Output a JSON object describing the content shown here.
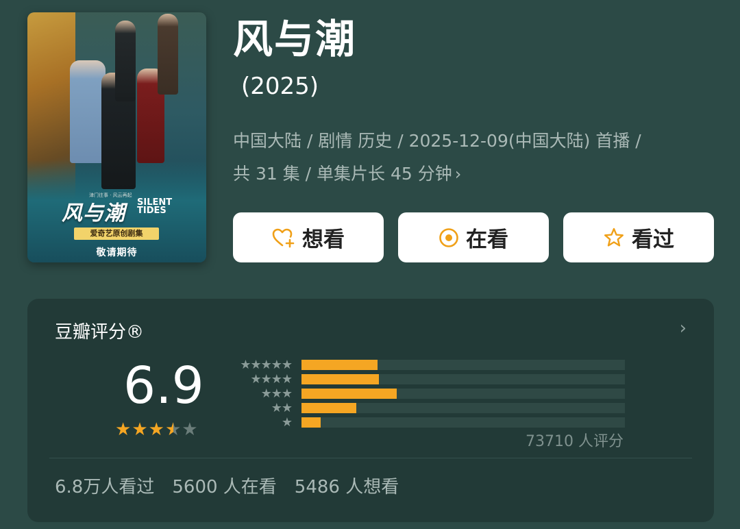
{
  "poster": {
    "title": "风与潮",
    "title_en": "SILENT TIDES",
    "tagline": "津门往事 · 风云再起",
    "tag": "爱奇艺原创剧集",
    "coming_soon": "敬请期待"
  },
  "show": {
    "title": "风与潮",
    "year": "(2025)",
    "meta_line1": "中国大陆 / 剧情 历史 / 2025-12-09(中国大陆) 首播 /",
    "meta_line2": "共 31 集 / 单集片长 45 分钟",
    "more_icon": "chevron-right-icon"
  },
  "actions": {
    "want": {
      "label": "想看",
      "icon": "heart-plus-icon"
    },
    "watching": {
      "label": "在看",
      "icon": "target-circle-icon"
    },
    "watched": {
      "label": "看过",
      "icon": "star-outline-icon"
    }
  },
  "rating": {
    "section_title": "豆瓣评分®",
    "score": "6.9",
    "stars_value": 3.5,
    "stars_max": 5,
    "distribution": [
      {
        "stars": "★★★★★",
        "fraction": 0.235
      },
      {
        "stars": "★★★★",
        "fraction": 0.24
      },
      {
        "stars": "★★★",
        "fraction": 0.295
      },
      {
        "stars": "★★",
        "fraction": 0.17
      },
      {
        "stars": "★",
        "fraction": 0.06
      }
    ],
    "count_label": "73710 人评分",
    "watched": "6.8万人看过",
    "watching": "5600 人在看",
    "want": "5486 人想看"
  },
  "colors": {
    "background": "#2c4a46",
    "card": "#223a37",
    "accent": "#f5a623",
    "muted_text": "#aab9b6"
  }
}
